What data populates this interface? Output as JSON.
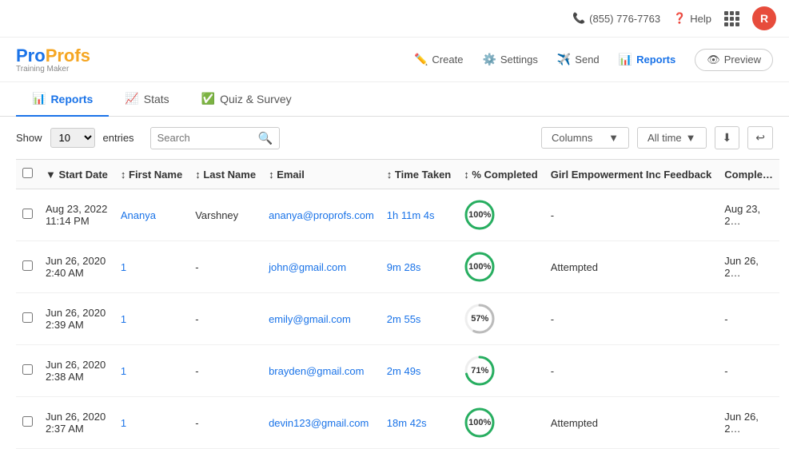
{
  "topbar": {
    "phone": "(855) 776-7763",
    "help": "Help",
    "avatar_letter": "R"
  },
  "header": {
    "logo_pro": "Pro",
    "logo_profs": "Profs",
    "logo_tagline": "Training Maker",
    "nav": [
      {
        "label": "Create",
        "icon": "✏️",
        "active": false
      },
      {
        "label": "Settings",
        "icon": "⚙️",
        "active": false
      },
      {
        "label": "Send",
        "icon": "✈️",
        "active": false
      },
      {
        "label": "Reports",
        "icon": "📊",
        "active": true
      },
      {
        "label": "Preview",
        "icon": "👁",
        "active": false,
        "btn": true
      }
    ]
  },
  "tabs": [
    {
      "label": "Reports",
      "icon": "📊",
      "active": true
    },
    {
      "label": "Stats",
      "icon": "📈",
      "active": false
    },
    {
      "label": "Quiz & Survey",
      "icon": "✅",
      "active": false
    }
  ],
  "controls": {
    "show_label": "Show",
    "entries_value": "10",
    "entries_label": "entries",
    "search_placeholder": "Search",
    "columns_label": "Columns",
    "alltime_label": "All time"
  },
  "table": {
    "columns": [
      {
        "key": "start_date",
        "label": "Start Date"
      },
      {
        "key": "first_name",
        "label": "First Name"
      },
      {
        "key": "last_name",
        "label": "Last Name"
      },
      {
        "key": "email",
        "label": "Email"
      },
      {
        "key": "time_taken",
        "label": "Time Taken"
      },
      {
        "key": "pct_completed",
        "label": "% Completed"
      },
      {
        "key": "feedback",
        "label": "Girl Empowerment Inc Feedback"
      },
      {
        "key": "completed",
        "label": "Comple…"
      }
    ],
    "rows": [
      {
        "start_date": "Aug 23, 2022 11:14 PM",
        "first_name": "Ananya",
        "last_name": "Varshney",
        "email": "ananya@proprofs.com",
        "time_taken": "1h 11m 4s",
        "pct_completed": 100,
        "pct_color": "#27ae60",
        "feedback": "-",
        "completed": "Aug 23, 2…"
      },
      {
        "start_date": "Jun 26, 2020 2:40 AM",
        "first_name": "1",
        "last_name": "-",
        "email": "john@gmail.com",
        "time_taken": "9m 28s",
        "pct_completed": 100,
        "pct_color": "#27ae60",
        "feedback": "Attempted",
        "completed": "Jun 26, 2…"
      },
      {
        "start_date": "Jun 26, 2020 2:39 AM",
        "first_name": "1",
        "last_name": "-",
        "email": "emily@gmail.com",
        "time_taken": "2m 55s",
        "pct_completed": 57,
        "pct_color": "#bbb",
        "feedback": "-",
        "completed": "-"
      },
      {
        "start_date": "Jun 26, 2020 2:38 AM",
        "first_name": "1",
        "last_name": "-",
        "email": "brayden@gmail.com",
        "time_taken": "2m 49s",
        "pct_completed": 71,
        "pct_color": "#27ae60",
        "feedback": "-",
        "completed": "-"
      },
      {
        "start_date": "Jun 26, 2020 2:37 AM",
        "first_name": "1",
        "last_name": "-",
        "email": "devin123@gmail.com",
        "time_taken": "18m 42s",
        "pct_completed": 100,
        "pct_color": "#27ae60",
        "feedback": "Attempted",
        "completed": "Jun 26, 2…"
      }
    ]
  }
}
